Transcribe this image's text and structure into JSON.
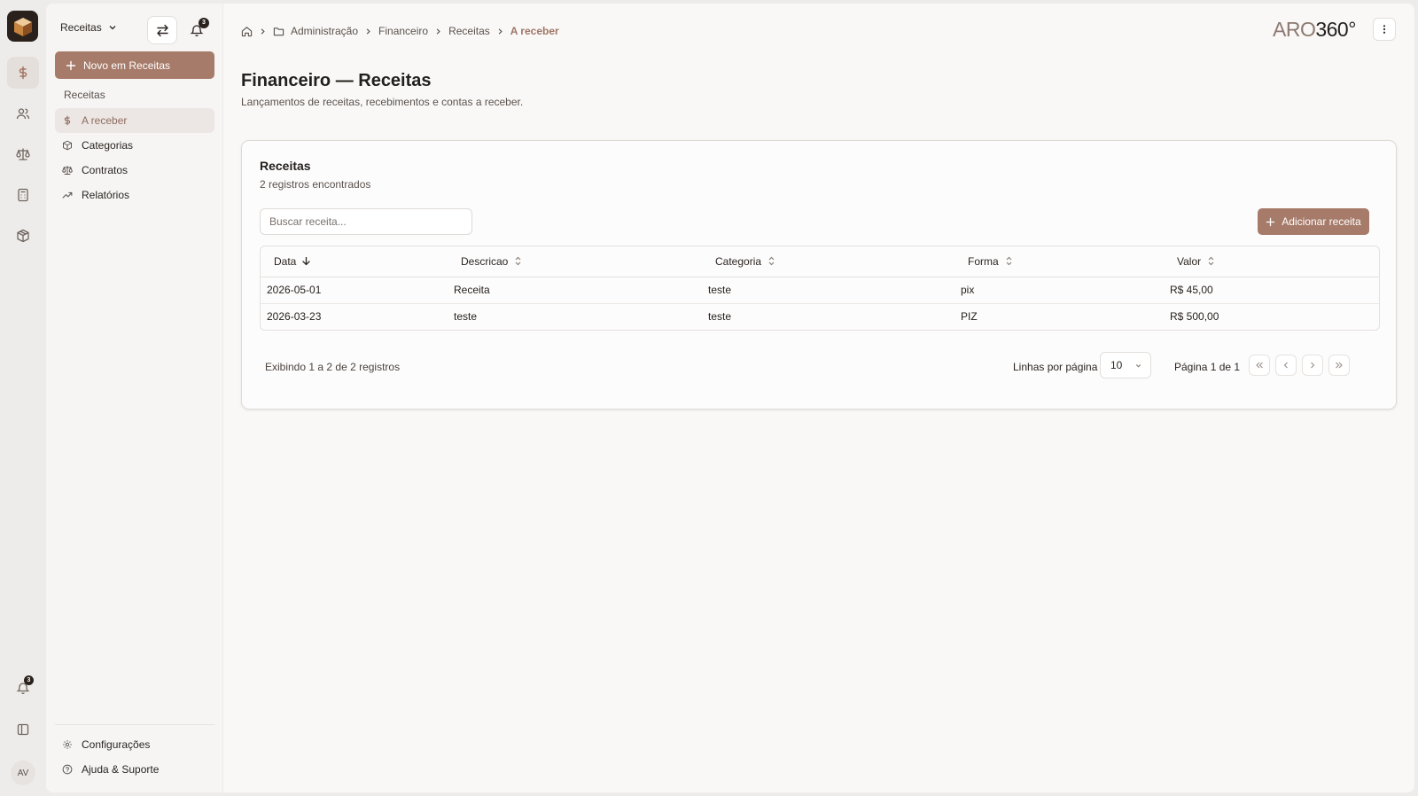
{
  "rail": {
    "notification_count": "3",
    "avatar_initials": "AV"
  },
  "sidebar": {
    "module": "Receitas",
    "notification_count": "3",
    "new_button": "Novo em Receitas",
    "section_label": "Receitas",
    "items": [
      {
        "label": "A receber",
        "icon": "dollar-icon"
      },
      {
        "label": "Categorias",
        "icon": "box-icon"
      },
      {
        "label": "Contratos",
        "icon": "scale-icon"
      },
      {
        "label": "Relatórios",
        "icon": "trend-icon"
      }
    ],
    "bottom_items": [
      {
        "label": "Configurações",
        "icon": "gear-icon"
      },
      {
        "label": "Ajuda & Suporte",
        "icon": "help-icon"
      }
    ]
  },
  "breadcrumb": {
    "items": [
      "Administração",
      "Financeiro",
      "Receitas"
    ],
    "current": "A receber"
  },
  "brand": {
    "prefix": "ARO",
    "suffix": "360°"
  },
  "page": {
    "title": "Financeiro — Receitas",
    "subtitle": "Lançamentos de receitas, recebimentos e contas a receber."
  },
  "card": {
    "title": "Receitas",
    "subtitle": "2 registros encontrados",
    "search_placeholder": "Buscar receita...",
    "add_button": "Adicionar receita"
  },
  "table": {
    "columns": [
      "Data",
      "Descricao",
      "Categoria",
      "Forma",
      "Valor"
    ],
    "rows": [
      {
        "data": "2026-05-01",
        "descricao": "Receita",
        "categoria": "teste",
        "forma": "pix",
        "valor": "R$ 45,00"
      },
      {
        "data": "2026-03-23",
        "descricao": "teste",
        "categoria": "teste",
        "forma": "PIZ",
        "valor": "R$ 500,00"
      }
    ]
  },
  "footer": {
    "count_text": "Exibindo 1 a 2 de 2 registros",
    "rows_label": "Linhas por página",
    "rows_value": "10",
    "page_text": "Página 1 de 1"
  },
  "colors": {
    "accent": "#a67b6a",
    "accent_text": "#9f7565",
    "dark": "#2a211c"
  }
}
